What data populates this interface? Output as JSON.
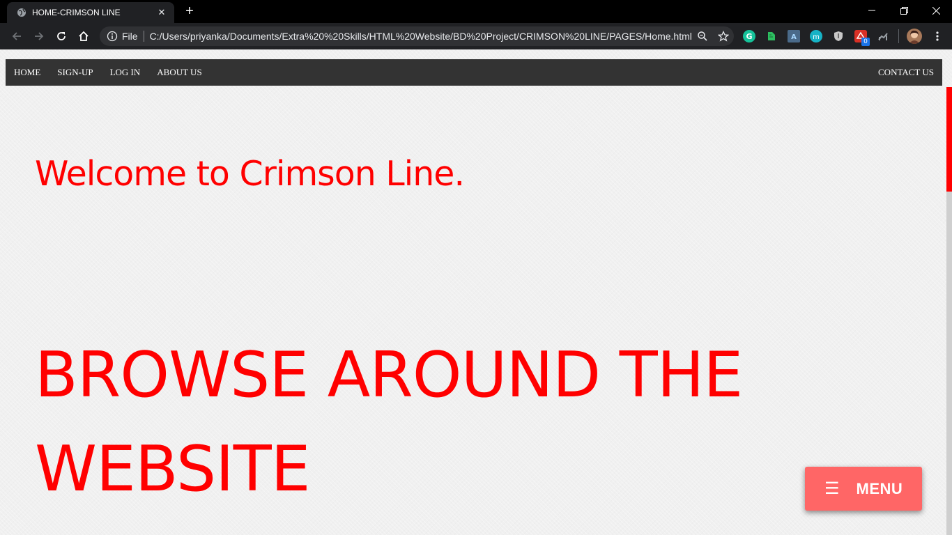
{
  "browser": {
    "tab_title": "HOME-CRIMSON LINE",
    "new_tab_symbol": "+",
    "close_tab_symbol": "✕",
    "omnibox_scheme_label": "File",
    "url": "C:/Users/priyanka/Documents/Extra%20%20Skills/HTML%20Website/BD%20Project/CRIMSON%20LINE/PAGES/Home.html",
    "extension_badge_count": "0",
    "icons": [
      "globe-icon",
      "back-icon",
      "forward-icon",
      "reload-icon",
      "home-icon",
      "info-icon",
      "zoom-icon",
      "star-icon",
      "grammarly-icon",
      "evernote-icon",
      "extension-icon",
      "m-icon",
      "shield-icon",
      "red-ext-icon",
      "chart-icon",
      "avatar",
      "kebab-menu-icon"
    ]
  },
  "nav": {
    "items": [
      "HOME",
      "SIGN-UP",
      "LOG IN",
      "ABOUT US"
    ],
    "contact": "CONTACT US"
  },
  "main": {
    "welcome": "Welcome to Crimson Line.",
    "browse": "BROWSE AROUND THE WEBSITE"
  },
  "menu_button": {
    "icon": "☰",
    "label": "MENU"
  },
  "colors": {
    "accent": "#ff0000",
    "nav_bg": "#333333",
    "menu_button_bg": "#ff6666",
    "page_bg": "#f0f0f0",
    "chrome_bg": "#202124"
  }
}
